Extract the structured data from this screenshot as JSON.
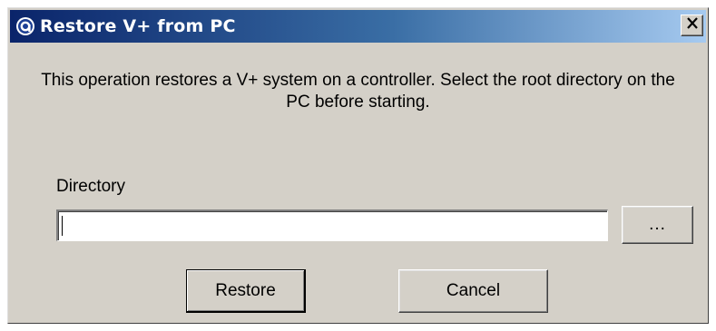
{
  "window": {
    "title": "Restore V+ from PC",
    "icon": "app-logo-icon",
    "close_icon": "close-icon",
    "titlebar_colors": [
      "#0a246a",
      "#a6caf0"
    ],
    "face_color": "#d4d0c8"
  },
  "description": "This operation restores a V+ system on a controller. Select the root directory on the PC before starting.",
  "directory": {
    "label": "Directory",
    "value": "",
    "browse_label": "..."
  },
  "buttons": {
    "restore_label": "Restore",
    "cancel_label": "Cancel"
  }
}
